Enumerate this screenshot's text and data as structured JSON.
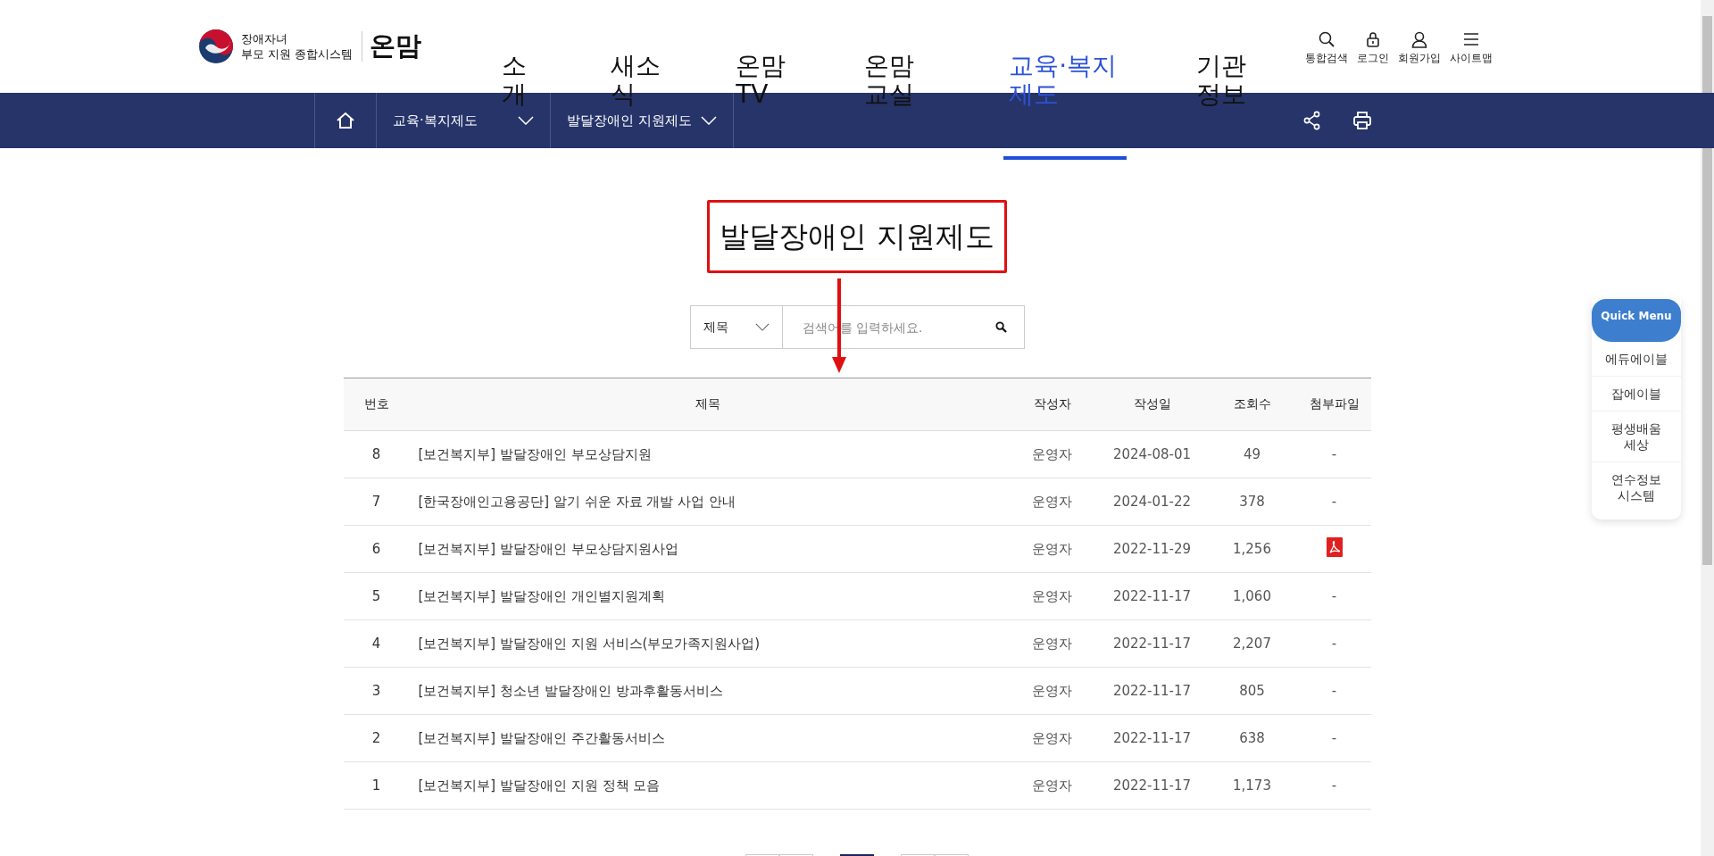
{
  "logo": {
    "line1": "장애자녀",
    "line2": "부모 지원 종합시스템",
    "brand": "온맘"
  },
  "nav": [
    {
      "label": "소개",
      "selected": false
    },
    {
      "label": "새소식",
      "selected": false
    },
    {
      "label": "온맘TV",
      "selected": false
    },
    {
      "label": "온맘교실",
      "selected": false
    },
    {
      "label": "교육·복지제도",
      "selected": true
    },
    {
      "label": "기관정보",
      "selected": false
    }
  ],
  "utilities": [
    {
      "kind": "search",
      "label": "통합검색"
    },
    {
      "kind": "lock",
      "label": "로그인"
    },
    {
      "kind": "user",
      "label": "회원가입"
    },
    {
      "kind": "menu",
      "label": "사이트맵"
    }
  ],
  "breadcrumb": [
    "교육·복지제도",
    "발달장애인 지원제도"
  ],
  "title": "발달장애인 지원제도",
  "search": {
    "field": "제목",
    "placeholder": "검색어를 입력하세요."
  },
  "table": {
    "columns": [
      "번호",
      "제목",
      "작성자",
      "작성일",
      "조회수",
      "첨부파일"
    ],
    "rows": [
      {
        "no": "8",
        "title": "[보건복지부] 발달장애인 부모상담지원",
        "author": "운영자",
        "date": "2024-08-01",
        "views": "49",
        "attachment": {
          "kind": "dash",
          "text": "-"
        }
      },
      {
        "no": "7",
        "title": "[한국장애인고용공단] 알기 쉬운 자료 개발 사업 안내",
        "author": "운영자",
        "date": "2024-01-22",
        "views": "378",
        "attachment": {
          "kind": "dash",
          "text": "-"
        }
      },
      {
        "no": "6",
        "title": "[보건복지부] 발달장애인 부모상담지원사업",
        "author": "운영자",
        "date": "2022-11-29",
        "views": "1,256",
        "attachment": {
          "kind": "pdf"
        }
      },
      {
        "no": "5",
        "title": "[보건복지부] 발달장애인 개인별지원계획",
        "author": "운영자",
        "date": "2022-11-17",
        "views": "1,060",
        "attachment": {
          "kind": "dash",
          "text": "-"
        }
      },
      {
        "no": "4",
        "title": "[보건복지부] 발달장애인 지원 서비스(부모가족지원사업)",
        "author": "운영자",
        "date": "2022-11-17",
        "views": "2,207",
        "attachment": {
          "kind": "dash",
          "text": "-"
        }
      },
      {
        "no": "3",
        "title": "[보건복지부] 청소년 발달장애인 방과후활동서비스",
        "author": "운영자",
        "date": "2022-11-17",
        "views": "805",
        "attachment": {
          "kind": "dash",
          "text": "-"
        }
      },
      {
        "no": "2",
        "title": "[보건복지부] 발달장애인 주간활동서비스",
        "author": "운영자",
        "date": "2022-11-17",
        "views": "638",
        "attachment": {
          "kind": "dash",
          "text": "-"
        }
      },
      {
        "no": "1",
        "title": "[보건복지부] 발달장애인 지원 정책 모음",
        "author": "운영자",
        "date": "2022-11-17",
        "views": "1,173",
        "attachment": {
          "kind": "dash",
          "text": "-"
        }
      }
    ]
  },
  "pagination": [
    {
      "selected": false
    },
    {
      "selected": false
    },
    {
      "selected": true
    },
    {
      "selected": false
    },
    {
      "selected": false
    }
  ],
  "quick_menu": {
    "title": "Quick Menu",
    "items": [
      "에듀에이블",
      "잡에이블",
      "평생배움 세상",
      "연수정보 시스템"
    ]
  }
}
